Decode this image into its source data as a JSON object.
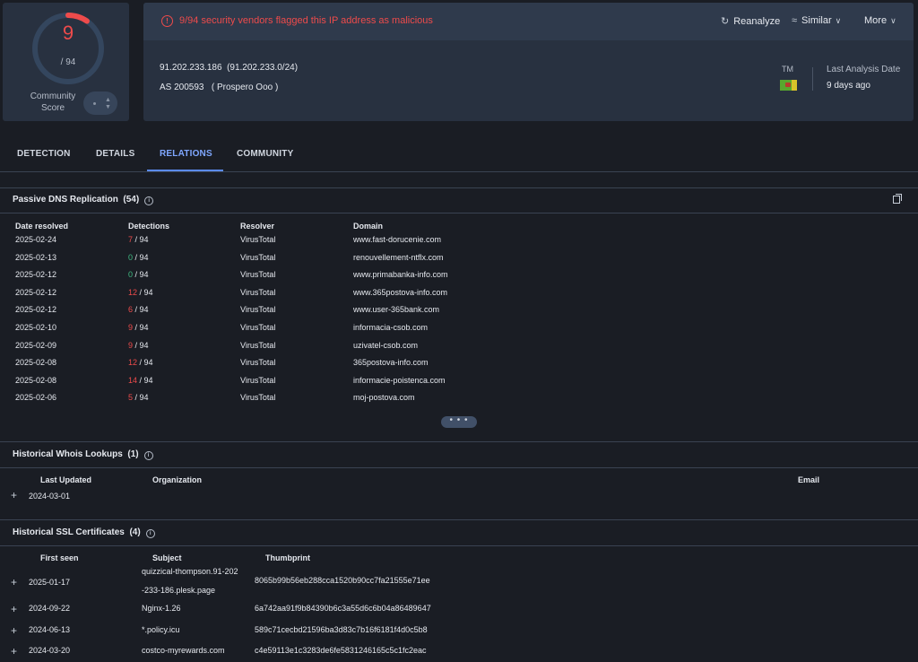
{
  "score": {
    "value": "9",
    "total": "/ 94",
    "ratio": 0.0957,
    "community_label_1": "Community",
    "community_label_2": "Score",
    "community_value": "-"
  },
  "alert": {
    "text": "9/94 security vendors flagged this IP address as malicious"
  },
  "actions": {
    "reanalyze": "Reanalyze",
    "similar": "Similar",
    "more": "More"
  },
  "ip": {
    "address": "91.202.233.186",
    "range": "(91.202.233.0/24)",
    "as_number": "AS 200593",
    "as_name": "( Prospero Ooo )",
    "country": "TM"
  },
  "last_analysis": {
    "label": "Last Analysis Date",
    "value": "9 days ago"
  },
  "tabs": [
    "DETECTION",
    "DETAILS",
    "RELATIONS",
    "COMMUNITY"
  ],
  "passive_dns": {
    "title": "Passive DNS Replication",
    "count": "(54)",
    "headers": [
      "Date resolved",
      "Detections",
      "Resolver",
      "Domain"
    ],
    "rows": [
      {
        "date": "2025-02-24",
        "det": "7",
        "total": "/ 94",
        "resolver": "VirusTotal",
        "domain": "www.fast-dorucenie.com"
      },
      {
        "date": "2025-02-13",
        "det": "0",
        "total": "/ 94",
        "resolver": "VirusTotal",
        "domain": "renouvellement-ntflx.com"
      },
      {
        "date": "2025-02-12",
        "det": "0",
        "total": "/ 94",
        "resolver": "VirusTotal",
        "domain": "www.primabanka-info.com"
      },
      {
        "date": "2025-02-12",
        "det": "12",
        "total": "/ 94",
        "resolver": "VirusTotal",
        "domain": "www.365postova-info.com"
      },
      {
        "date": "2025-02-12",
        "det": "6",
        "total": "/ 94",
        "resolver": "VirusTotal",
        "domain": "www.user-365bank.com"
      },
      {
        "date": "2025-02-10",
        "det": "9",
        "total": "/ 94",
        "resolver": "VirusTotal",
        "domain": "informacia-csob.com"
      },
      {
        "date": "2025-02-09",
        "det": "9",
        "total": "/ 94",
        "resolver": "VirusTotal",
        "domain": "uzivatel-csob.com"
      },
      {
        "date": "2025-02-08",
        "det": "12",
        "total": "/ 94",
        "resolver": "VirusTotal",
        "domain": "365postova-info.com"
      },
      {
        "date": "2025-02-08",
        "det": "14",
        "total": "/ 94",
        "resolver": "VirusTotal",
        "domain": "informacie-poistenca.com"
      },
      {
        "date": "2025-02-06",
        "det": "5",
        "total": "/ 94",
        "resolver": "VirusTotal",
        "domain": "moj-postova.com"
      }
    ],
    "more": "• • •"
  },
  "whois": {
    "title": "Historical Whois Lookups",
    "count": "(1)",
    "headers": [
      "Last Updated",
      "Organization",
      "Email"
    ],
    "rows": [
      {
        "date": "2024-03-01"
      }
    ]
  },
  "ssl": {
    "title": "Historical SSL Certificates",
    "count": "(4)",
    "headers": [
      "First seen",
      "Subject",
      "Thumbprint"
    ],
    "rows": [
      {
        "date": "2025-01-17",
        "subject_1": "quizzical-thompson.91-202",
        "subject_2": "-233-186.plesk.page",
        "thumb": "8065b99b56eb288cca1520b90cc7fa21555e71ee"
      },
      {
        "date": "2024-09-22",
        "subject_1": "Nginx-1.26",
        "subject_2": "",
        "thumb": "6a742aa91f9b84390b6c3a55d6c6b04a86489647"
      },
      {
        "date": "2024-06-13",
        "subject_1": "*.policy.icu",
        "subject_2": "",
        "thumb": "589c71cecbd21596ba3d83c7b16f6181f4d0c5b8"
      },
      {
        "date": "2024-03-20",
        "subject_1": "costco-myrewards.com",
        "subject_2": "",
        "thumb": "c4e59113e1c3283de6fe5831246165c5c1fc2eac"
      }
    ]
  },
  "colors": {
    "malicious": "#ee4b4b",
    "clean": "#3fba82",
    "accent": "#5b8af0"
  }
}
